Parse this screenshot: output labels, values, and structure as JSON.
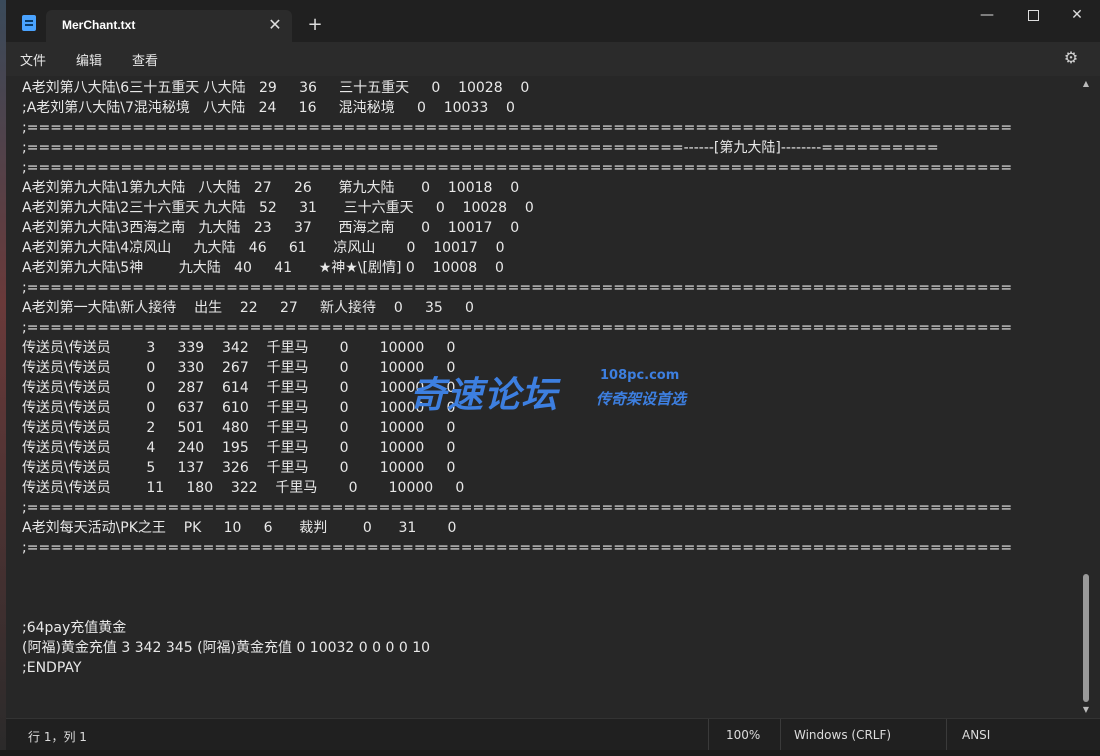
{
  "window": {
    "tab_title": "MerChant.txt",
    "tab_close_glyph": "✕",
    "new_tab_glyph": "+",
    "minimize_glyph": "—",
    "close_glyph": "✕"
  },
  "menu": {
    "file": "文件",
    "edit": "编辑",
    "view": "查看"
  },
  "editor": {
    "lines": [
      "A老刘第八大陆\\6三十五重天 八大陆   29     36     三十五重天     0    10028    0",
      ";A老刘第八大陆\\7混沌秘境   八大陆   24     16     混沌秘境     0    10033    0",
      ";====================================================================================",
      ";========================================================------[第九大陆]--------==========",
      ";====================================================================================",
      "A老刘第九大陆\\1第九大陆   八大陆   27     26      第九大陆      0    10018    0",
      "A老刘第九大陆\\2三十六重天 九大陆   52     31      三十六重天     0    10028    0",
      "A老刘第九大陆\\3西海之南   九大陆   23     37      西海之南      0    10017    0",
      "A老刘第九大陆\\4凉风山     九大陆   46     61      凉风山       0    10017    0",
      "A老刘第九大陆\\5神        九大陆   40     41      ★神★\\[剧情] 0    10008    0",
      ";====================================================================================",
      "A老刘第一大陆\\新人接待    出生    22     27     新人接待    0     35     0",
      ";====================================================================================",
      "传送员\\传送员        3     339    342    千里马       0       10000     0",
      "传送员\\传送员        0     330    267    千里马       0       10000     0",
      "传送员\\传送员        0     287    614    千里马       0       10000     0",
      "传送员\\传送员        0     637    610    千里马       0       10000     0",
      "传送员\\传送员        2     501    480    千里马       0       10000     0",
      "传送员\\传送员        4     240    195    千里马       0       10000     0",
      "传送员\\传送员        5     137    326    千里马       0       10000     0",
      "传送员\\传送员        11     180    322    千里马       0       10000     0",
      ";====================================================================================",
      "A老刘每天活动\\PK之王    PK     10     6      裁判        0      31       0",
      ";====================================================================================",
      "",
      "",
      "",
      ";64pay充值黄金",
      "(阿福)黄金充值 3 342 345 (阿福)黄金充值 0 10032 0 0 0 0 10",
      ";ENDPAY"
    ]
  },
  "status": {
    "position": "行 1，列 1",
    "zoom": "100%",
    "line_ending": "Windows (CRLF)",
    "encoding": "ANSI"
  },
  "watermark": {
    "main": "奇速论坛",
    "url": "108pc.com",
    "sub": "传奇架设首选"
  },
  "icons": {
    "app": "notepad-icon",
    "settings": "gear-icon"
  }
}
